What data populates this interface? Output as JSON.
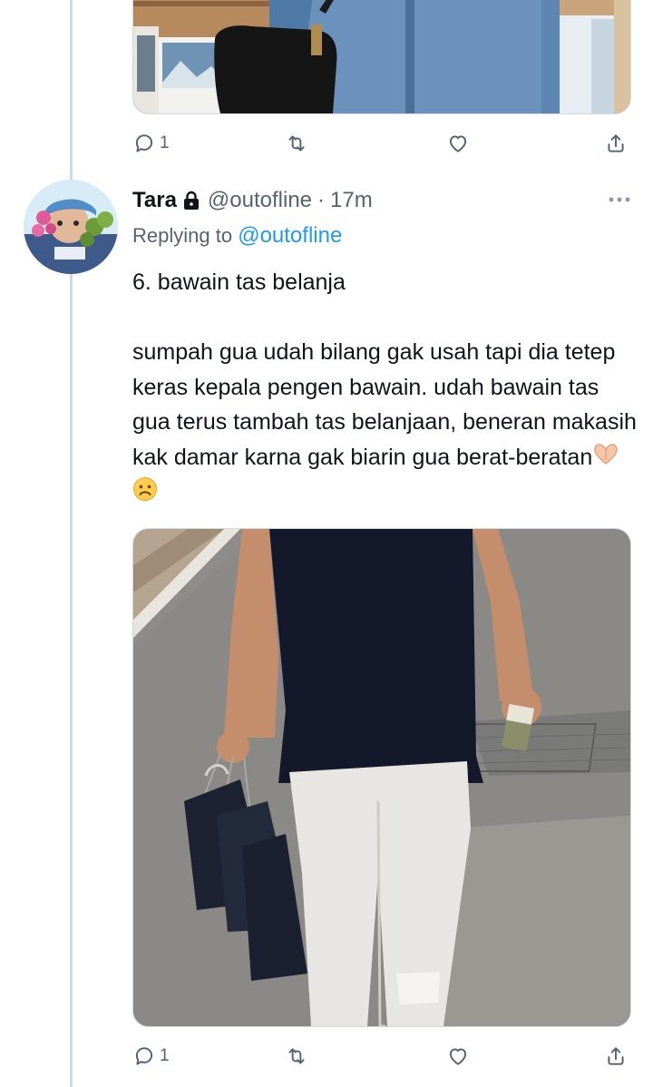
{
  "tweet": {
    "author_name": "Tara",
    "author_handle": "@outofline",
    "separator": "·",
    "time": "17m",
    "replying_prefix": "Replying to",
    "replying_to": "@outofline",
    "text_line1": "6. bawain tas belanja",
    "text_line2": "sumpah gua udah bilang gak usah tapi dia tetep keras kepala pengen bawain. udah bawain tas gua terus tambah tas belanjaan, beneran makasih kak damar karna gak biarin gua berat-beratan",
    "emojis": [
      "heart-hands-icon",
      "frowning-face-icon"
    ]
  },
  "previous_tweet_actions": {
    "reply_count": "1"
  },
  "tweet_actions": {
    "reply_count": "1"
  },
  "colors": {
    "link": "#1d9bf0",
    "secondary_text": "#536471",
    "thread_line": "#cfd9de"
  }
}
